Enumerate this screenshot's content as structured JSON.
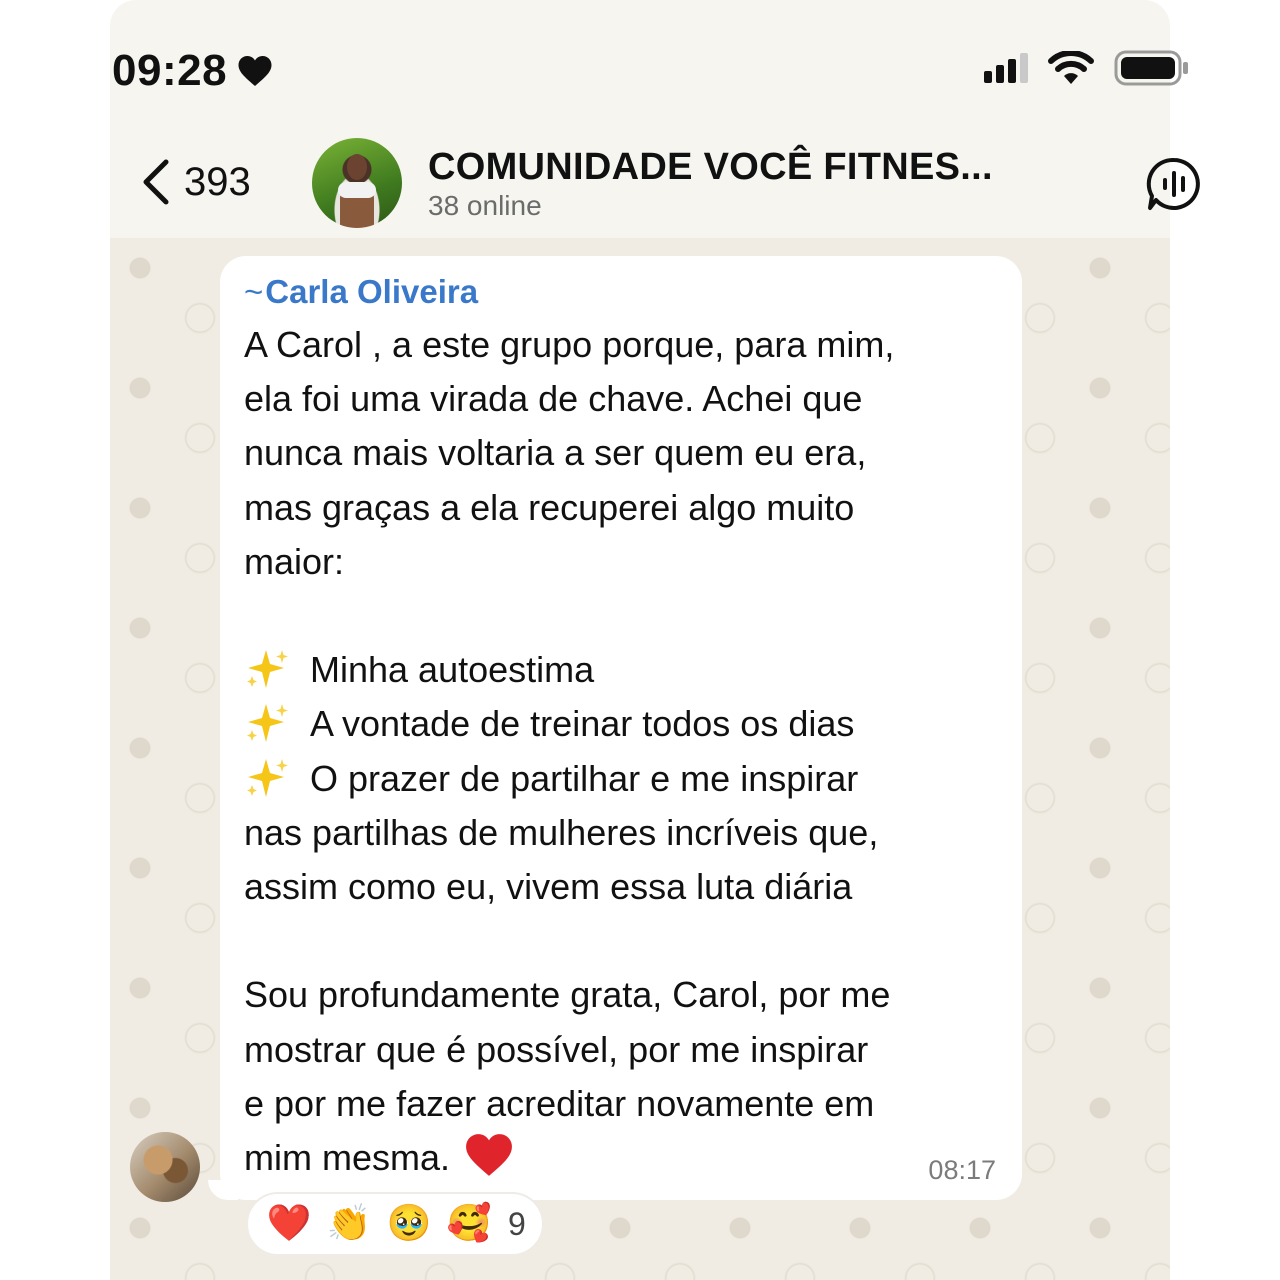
{
  "status_bar": {
    "time": "09:28",
    "time_icon": "heart-icon"
  },
  "header": {
    "back_count": "393",
    "group_name": "COMUNIDADE VOCÊ FITNES...",
    "online_status": "38 online",
    "action_icon": "audio-call-icon"
  },
  "message": {
    "sender_prefix": "~",
    "sender_name": "Carla Oliveira",
    "paragraph1": [
      "A Carol , a este grupo porque, para mim,",
      "ela foi uma virada de chave. Achei que",
      "nunca mais voltaria a ser quem eu era,",
      "mas graças a ela recuperei algo muito",
      "maior:"
    ],
    "bullets": [
      "Minha autoestima",
      "A vontade de treinar todos os dias",
      "O prazer de partilhar e me inspirar"
    ],
    "paragraph2": [
      "nas partilhas de mulheres incríveis que,",
      "assim como eu, vivem essa luta diária"
    ],
    "paragraph3": [
      "Sou profundamente grata, Carol, por me",
      "mostrar que é possível, por me inspirar",
      "e por me fazer acreditar novamente em",
      "mim mesma."
    ],
    "time": "08:17"
  },
  "reactions": {
    "emojis": [
      "❤️",
      "👏",
      "🥹",
      "🥰"
    ],
    "count": "9"
  },
  "colors": {
    "sender": "#3a78c9",
    "heart": "#e0242c",
    "sparkle": "#f5c518"
  }
}
